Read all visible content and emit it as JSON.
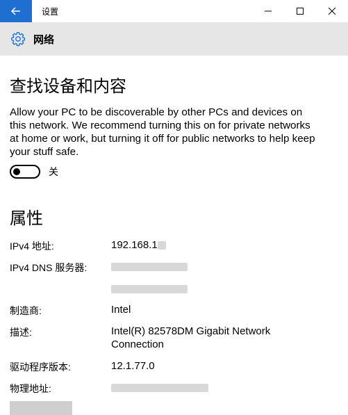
{
  "window": {
    "title": "设置"
  },
  "header": {
    "title": "网络"
  },
  "discovery": {
    "heading": "查找设备和内容",
    "description": "Allow your PC to be discoverable by other PCs and devices on this network. We recommend turning this on for private networks at home or work, but turning it off for public networks to help keep your stuff safe.",
    "toggle_state": "关"
  },
  "properties": {
    "heading": "属性",
    "rows": [
      {
        "label": "IPv4 地址:",
        "value": "192.168.1"
      },
      {
        "label": "IPv4 DNS 服务器:",
        "value": ""
      },
      {
        "label": "制造商:",
        "value": "Intel"
      },
      {
        "label": "描述:",
        "value": "Intel(R) 82578DM Gigabit Network Connection"
      },
      {
        "label": "驱动程序版本:",
        "value": "12.1.77.0"
      },
      {
        "label": "物理地址:",
        "value": ""
      }
    ]
  },
  "colors": {
    "accent": "#1f6fd1",
    "header_bg": "#e6e6e6"
  }
}
